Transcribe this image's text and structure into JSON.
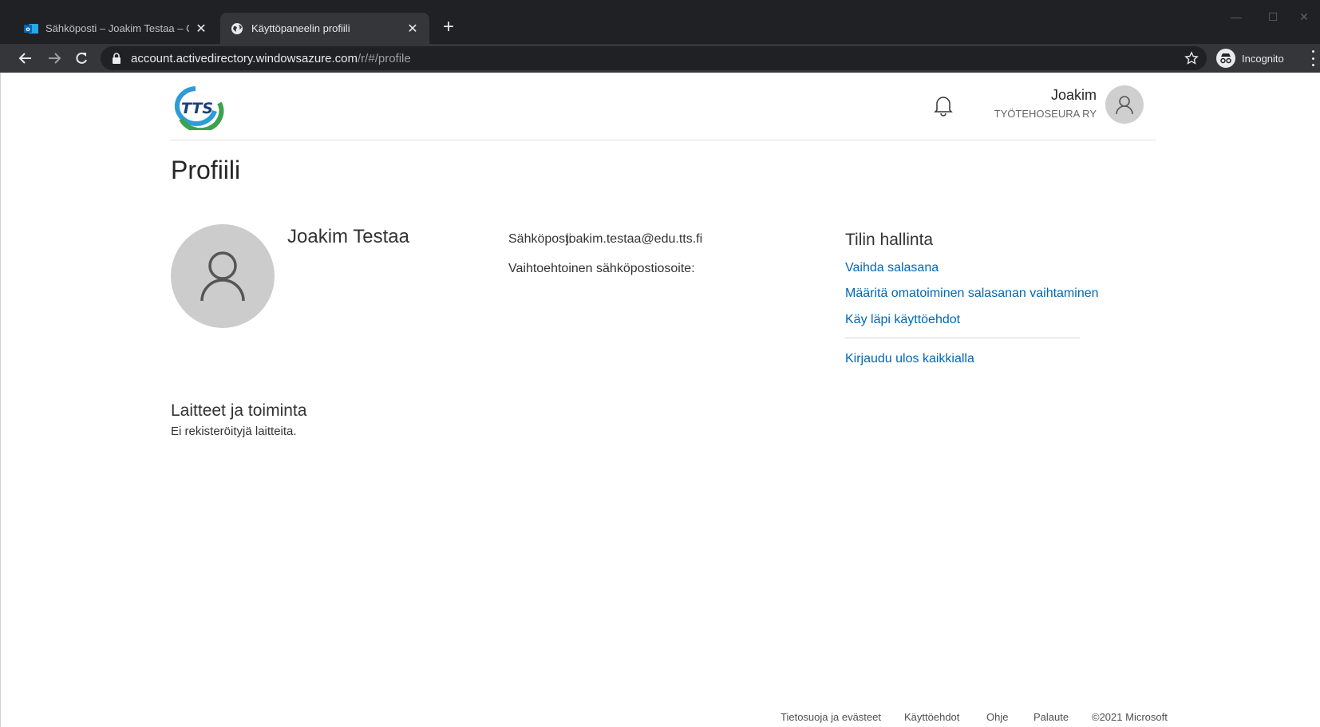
{
  "browser": {
    "tabs": [
      {
        "title": "Sähköposti – Joakim Testaa – Outlook",
        "active": false
      },
      {
        "title": "Käyttöpaneelin profiili",
        "active": true
      }
    ],
    "url_host": "account.activedirectory.windowsazure.com",
    "url_path": "/r/#/profile",
    "incognito_label": "Incognito"
  },
  "header": {
    "logo_text": "TTS",
    "user_name": "Joakim",
    "user_org": "TYÖTEHOSEURA RY"
  },
  "profile": {
    "title": "Profiili",
    "display_name": "Joakim Testaa",
    "email_label": "Sähköposti",
    "email_value": "joakim.testaa@edu.tts.fi",
    "alt_email_label": "Vaihtoehtoinen sähköpostiosoite:"
  },
  "account_management": {
    "heading": "Tilin hallinta",
    "links": [
      "Vaihda salasana",
      "Määritä omatoiminen salasanan vaihtaminen",
      "Käy läpi käyttöehdot"
    ],
    "signout_link": "Kirjaudu ulos kaikkialla"
  },
  "devices": {
    "heading": "Laitteet ja toiminta",
    "empty_text": "Ei rekisteröityjä laitteita."
  },
  "footer": {
    "links": [
      "Tietosuoja ja evästeet",
      "Käyttöehdot",
      "Ohje",
      "Palaute"
    ],
    "copyright": "©2021 Microsoft"
  },
  "colors": {
    "link": "#0067b8",
    "chrome_dark": "#202124",
    "chrome_toolbar": "#35363a"
  }
}
